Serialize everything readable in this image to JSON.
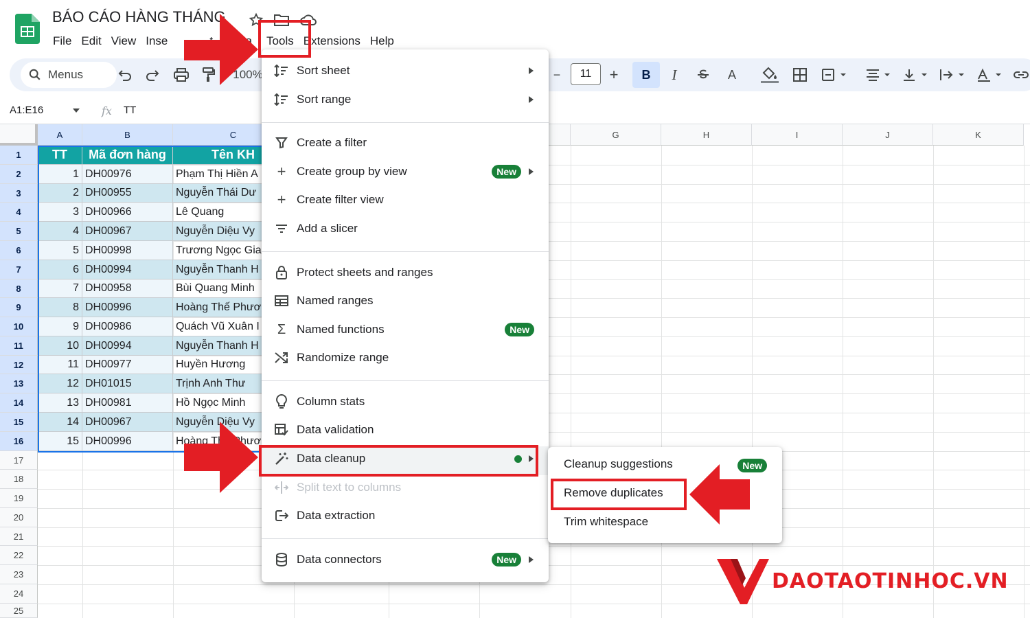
{
  "app": {
    "title": "BÁO CÁO HÀNG THÁNG",
    "menubar": [
      "File",
      "Edit",
      "View",
      "Inse",
      "t",
      "Data",
      "Tools",
      "Extensions",
      "Help"
    ]
  },
  "toolbar": {
    "search_label": "Menus",
    "zoom": "100%",
    "font_size": "11",
    "bold": "B",
    "italic": "I",
    "text_color": "A"
  },
  "formula_bar": {
    "name_box": "A1:E16",
    "fx": "fx",
    "formula": "TT"
  },
  "columns": [
    "A",
    "B",
    "C",
    "G",
    "H",
    "I",
    "J",
    "K"
  ],
  "rows": [
    "1",
    "2",
    "3",
    "4",
    "5",
    "6",
    "7",
    "8",
    "9",
    "10",
    "11",
    "12",
    "13",
    "14",
    "15",
    "16",
    "17",
    "18",
    "19",
    "20",
    "21",
    "22",
    "23",
    "24",
    "25"
  ],
  "table": {
    "headers": [
      "TT",
      "Mã đơn hàng",
      "Tên KH"
    ],
    "rows": [
      [
        "1",
        "DH00976",
        "Phạm Thị Hiền A"
      ],
      [
        "2",
        "DH00955",
        "Nguyễn Thái Dư"
      ],
      [
        "3",
        "DH00966",
        "Lê Quang"
      ],
      [
        "4",
        "DH00967",
        "Nguyễn Diệu Vy"
      ],
      [
        "5",
        "DH00998",
        "Trương Ngọc Gia"
      ],
      [
        "6",
        "DH00994",
        "Nguyễn Thanh H"
      ],
      [
        "7",
        "DH00958",
        "Bùi Quang Minh"
      ],
      [
        "8",
        "DH00996",
        "Hoàng Thế Phươ"
      ],
      [
        "9",
        "DH00986",
        "Quách Vũ Xuân I"
      ],
      [
        "10",
        "DH00994",
        "Nguyễn Thanh H"
      ],
      [
        "11",
        "DH00977",
        "Huyền Hương"
      ],
      [
        "12",
        "DH01015",
        "Trịnh Anh Thư"
      ],
      [
        "13",
        "DH00981",
        "Hồ Ngọc Minh"
      ],
      [
        "14",
        "DH00967",
        "Nguyễn Diệu Vy"
      ],
      [
        "15",
        "DH00996",
        "Hoàng Thế Phươ"
      ]
    ]
  },
  "data_menu": {
    "sort_sheet": "Sort sheet",
    "sort_range": "Sort range",
    "create_filter": "Create a filter",
    "create_group_by_view": "Create group by view",
    "create_filter_view": "Create filter view",
    "add_slicer": "Add a slicer",
    "protect": "Protect sheets and ranges",
    "named_ranges": "Named ranges",
    "named_functions": "Named functions",
    "randomize_range": "Randomize range",
    "column_stats": "Column stats",
    "data_validation": "Data validation",
    "data_cleanup": "Data cleanup",
    "split_text": "Split text to columns",
    "data_extraction": "Data extraction",
    "data_connectors": "Data connectors",
    "new_badge": "New"
  },
  "cleanup_submenu": {
    "cleanup_suggestions": "Cleanup suggestions",
    "remove_duplicates": "Remove duplicates",
    "trim_whitespace": "Trim whitespace",
    "new_badge": "New"
  },
  "watermark": {
    "text": "DAOTAOTINHOC.VN"
  },
  "colors": {
    "header_teal": "#12a3a3",
    "band_blue": "#cfe7f0",
    "annotation_red": "#e31e24",
    "badge_green": "#188038",
    "toolbar_bg": "#edf2fa"
  }
}
